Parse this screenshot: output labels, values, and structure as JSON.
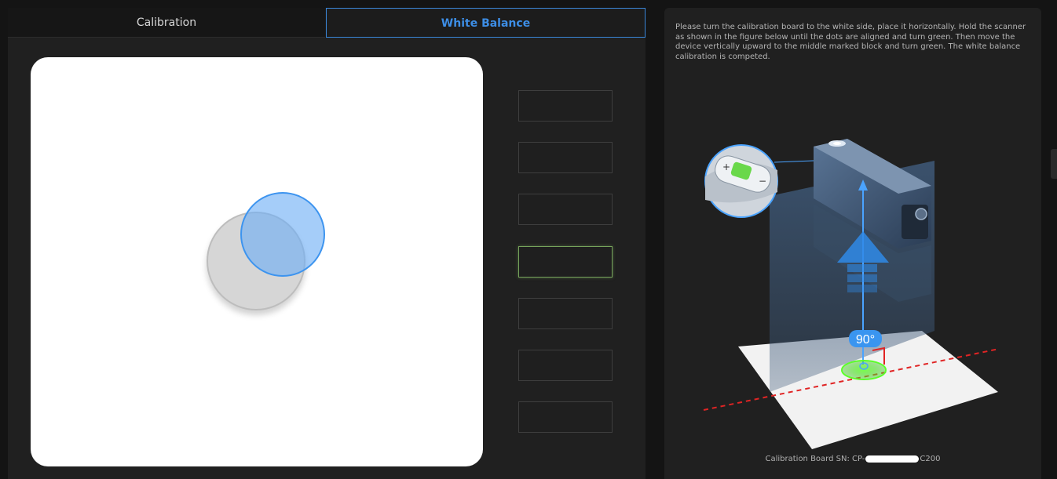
{
  "tabs": [
    {
      "label": "Calibration",
      "active": false
    },
    {
      "label": "White Balance",
      "active": true
    }
  ],
  "progress": {
    "total_blocks": 7,
    "active_block": 4
  },
  "instructions": "Please turn the calibration board to the white side, place it horizontally. Hold the scanner as shown in the figure below until the dots are aligned and turn green. Then move the device vertically upward to the middle marked block and turn green. The white balance calibration is competed.",
  "illustration": {
    "angle_label": "90°"
  },
  "calibration_board": {
    "label": "Calibration Board SN: CP-",
    "suffix": "C200"
  },
  "colors": {
    "accent": "#3d8ee6",
    "active_block": "#76a35b",
    "background": "#202020"
  }
}
